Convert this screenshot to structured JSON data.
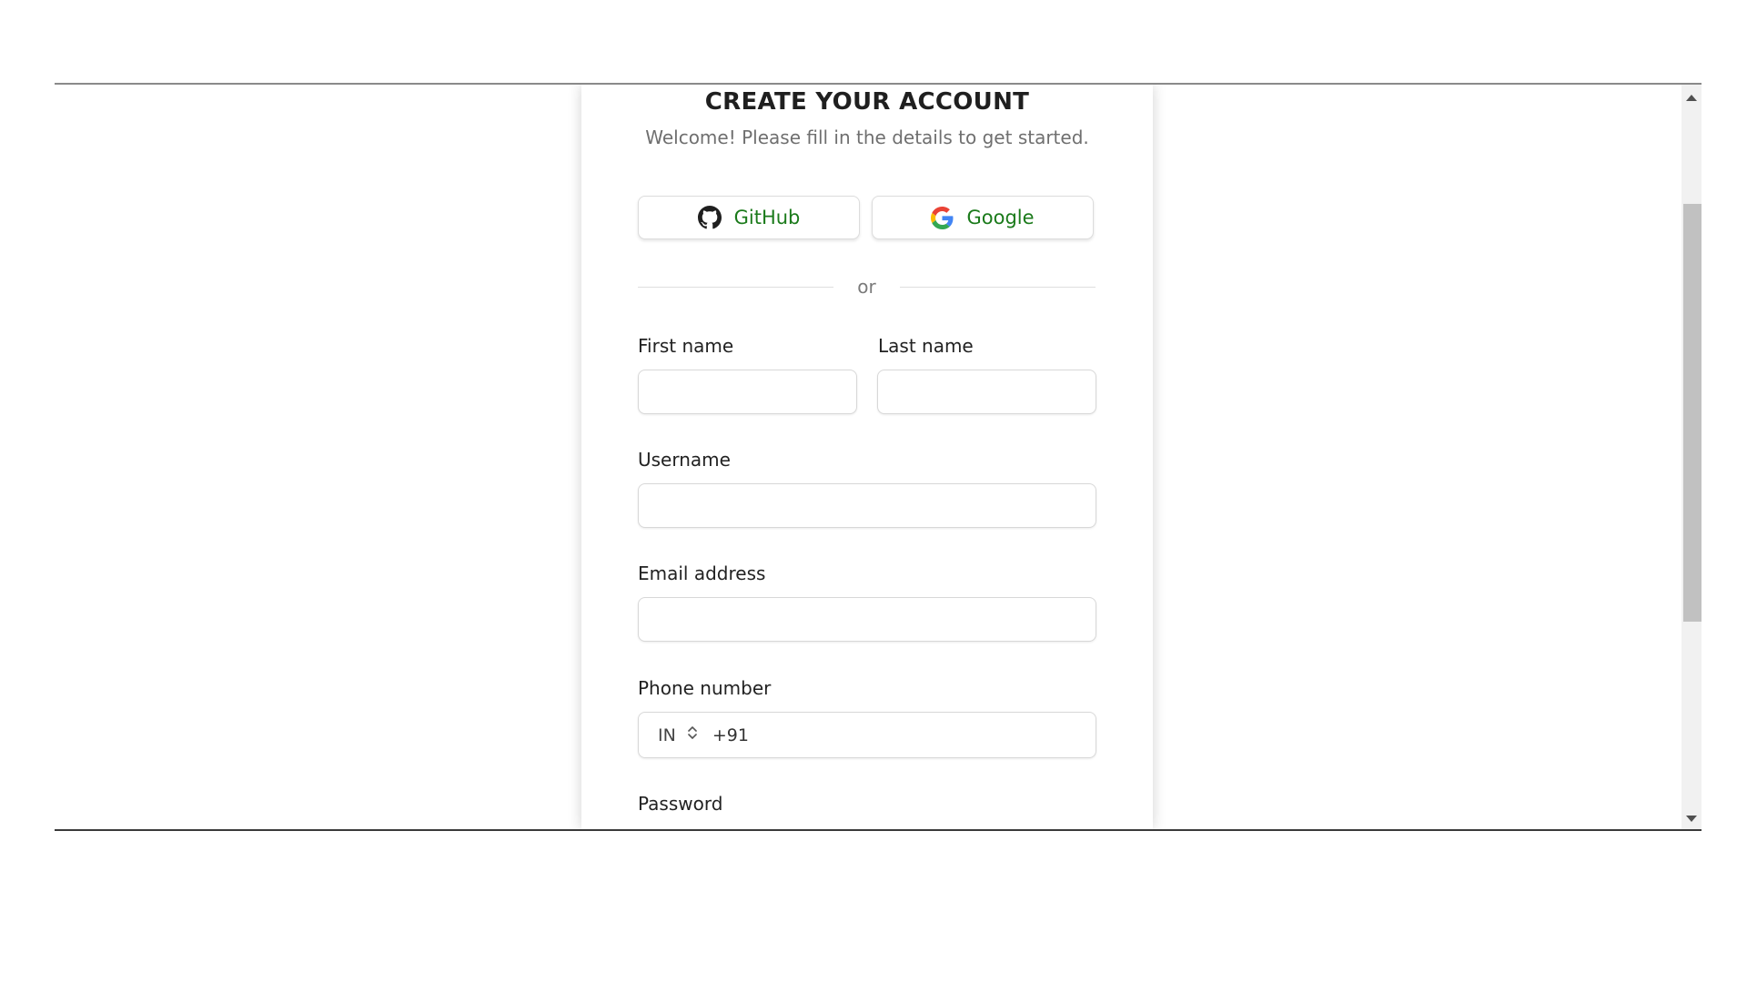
{
  "header": {
    "title": "CREATE YOUR ACCOUNT",
    "subtitle": "Welcome! Please fill in the details to get started."
  },
  "social": {
    "github_label": "GitHub",
    "google_label": "Google",
    "github_icon": "github-icon",
    "google_icon": "google-icon",
    "label_color": "#1a7a1a"
  },
  "divider": {
    "text": "or"
  },
  "form": {
    "first_name": {
      "label": "First name",
      "value": "",
      "placeholder": ""
    },
    "last_name": {
      "label": "Last name",
      "value": "",
      "placeholder": ""
    },
    "username": {
      "label": "Username",
      "value": "",
      "placeholder": ""
    },
    "email": {
      "label": "Email address",
      "value": "",
      "placeholder": ""
    },
    "phone": {
      "label": "Phone number",
      "country": "IN",
      "dial_code": "+91",
      "value": ""
    },
    "password": {
      "label": "Password"
    }
  }
}
